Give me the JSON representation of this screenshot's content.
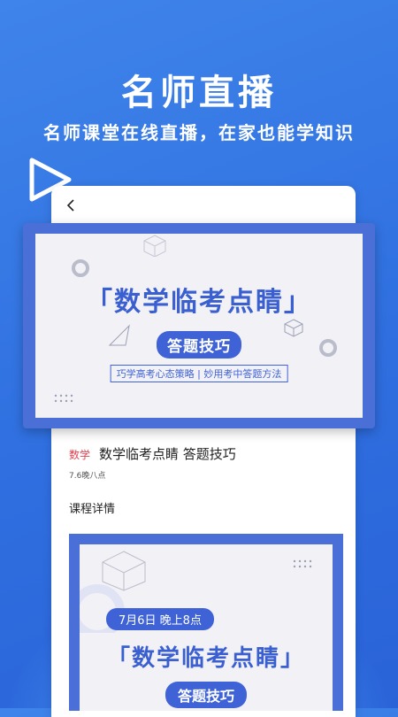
{
  "hero": {
    "title": "名师直播",
    "subtitle": "名师课堂在线直播，在家也能学知识"
  },
  "banner": {
    "title": "「数学临考点睛」",
    "pill": "答题技巧",
    "tagline": "巧学高考心态策略 | 妙用考中答题方法"
  },
  "course": {
    "subject": "数学",
    "name": "数学临考点睛  答题技巧",
    "time": "7.6晚八点",
    "detail_label": "课程详情"
  },
  "poster": {
    "date": "7月6日 晚上8点",
    "title": "「数学临考点睛」",
    "pill": "答题技巧"
  },
  "colors": {
    "background": "#3f84ea",
    "accent_blue": "#3f63d6",
    "subject_red": "#e2424f"
  },
  "icons": [
    "play-icon",
    "back-arrow-icon"
  ]
}
